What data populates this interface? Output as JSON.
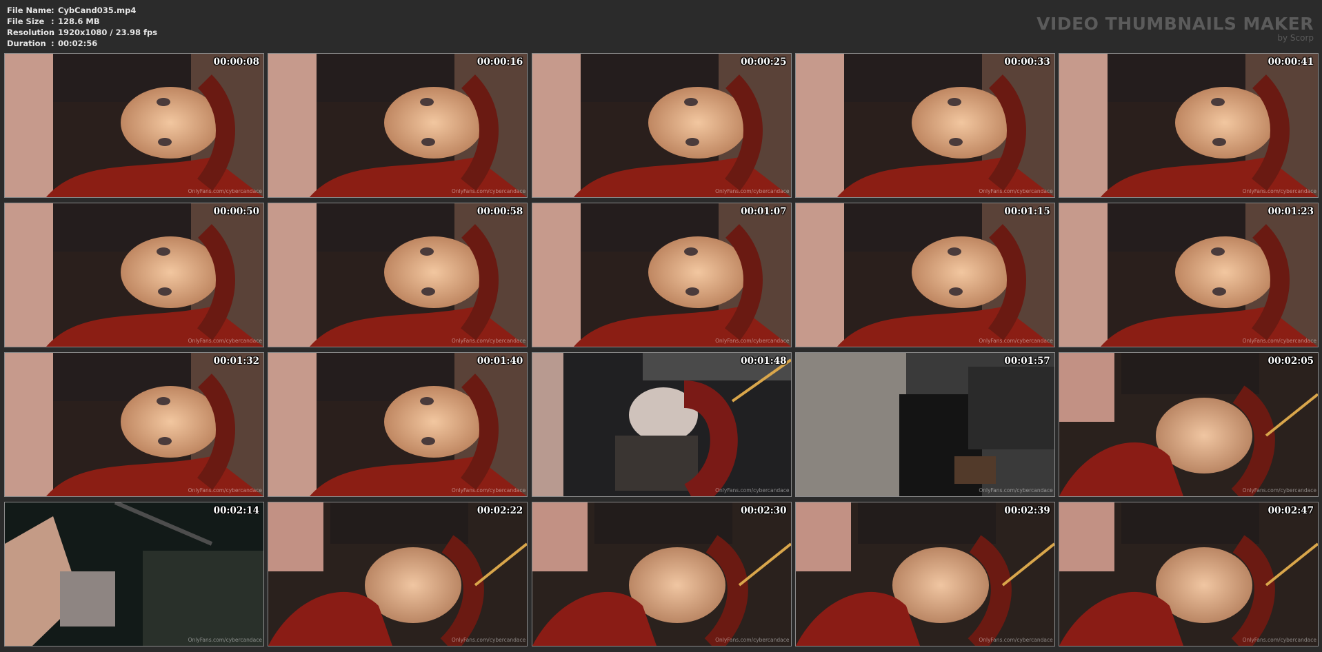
{
  "info": {
    "file_name_label": "File Name",
    "file_name": "CybCand035.mp4",
    "file_size_label": "File Size",
    "file_size": "128.6 MB",
    "resolution_label": "Resolution",
    "resolution": "1920x1080 / 23.98 fps",
    "duration_label": "Duration",
    "duration": "00:02:56",
    "separator": ":"
  },
  "brand": {
    "title": "VIDEO THUMBNAILS MAKER",
    "subtitle": "by Scorp"
  },
  "thumbnails": [
    {
      "timestamp": "00:00:08",
      "watermark": "OnlyFans.com/cybercandace",
      "scene": "face"
    },
    {
      "timestamp": "00:00:16",
      "watermark": "OnlyFans.com/cybercandace",
      "scene": "face"
    },
    {
      "timestamp": "00:00:25",
      "watermark": "OnlyFans.com/cybercandace",
      "scene": "face"
    },
    {
      "timestamp": "00:00:33",
      "watermark": "OnlyFans.com/cybercandace",
      "scene": "face"
    },
    {
      "timestamp": "00:00:41",
      "watermark": "OnlyFans.com/cybercandace",
      "scene": "face"
    },
    {
      "timestamp": "00:00:50",
      "watermark": "OnlyFans.com/cybercandace",
      "scene": "face"
    },
    {
      "timestamp": "00:00:58",
      "watermark": "OnlyFans.com/cybercandace",
      "scene": "face"
    },
    {
      "timestamp": "00:01:07",
      "watermark": "OnlyFans.com/cybercandace",
      "scene": "face"
    },
    {
      "timestamp": "00:01:15",
      "watermark": "OnlyFans.com/cybercandace",
      "scene": "face"
    },
    {
      "timestamp": "00:01:23",
      "watermark": "OnlyFans.com/cybercandace",
      "scene": "face"
    },
    {
      "timestamp": "00:01:32",
      "watermark": "OnlyFans.com/cybercandace",
      "scene": "face"
    },
    {
      "timestamp": "00:01:40",
      "watermark": "OnlyFans.com/cybercandace",
      "scene": "face"
    },
    {
      "timestamp": "00:01:48",
      "watermark": "OnlyFans.com/cybercandace",
      "scene": "dark-face"
    },
    {
      "timestamp": "00:01:57",
      "watermark": "OnlyFans.com/cybercandace",
      "scene": "blur"
    },
    {
      "timestamp": "00:02:05",
      "watermark": "OnlyFans.com/cybercandace",
      "scene": "face-lamp"
    },
    {
      "timestamp": "00:02:14",
      "watermark": "OnlyFans.com/cybercandace",
      "scene": "dark"
    },
    {
      "timestamp": "00:02:22",
      "watermark": "OnlyFans.com/cybercandace",
      "scene": "face-lamp"
    },
    {
      "timestamp": "00:02:30",
      "watermark": "OnlyFans.com/cybercandace",
      "scene": "face-lamp"
    },
    {
      "timestamp": "00:02:39",
      "watermark": "OnlyFans.com/cybercandace",
      "scene": "face-lamp"
    },
    {
      "timestamp": "00:02:47",
      "watermark": "OnlyFans.com/cybercandace",
      "scene": "face-lamp"
    }
  ],
  "colors": {
    "background": "#2b2b2b",
    "text": "#e6e6e6",
    "brand": "#5b5b5b",
    "thumb_border": "#8a8a8a"
  }
}
